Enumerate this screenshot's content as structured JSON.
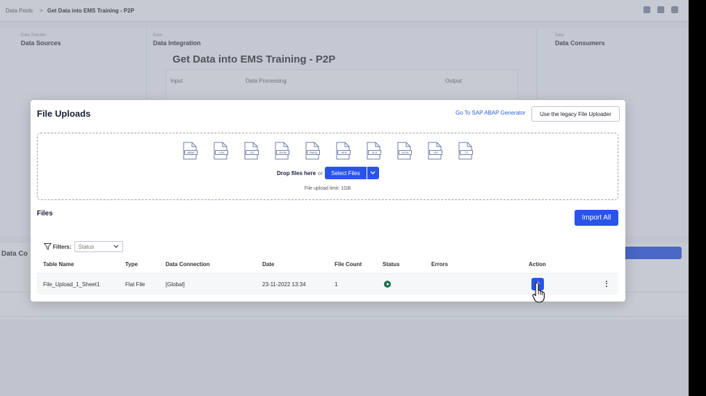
{
  "background": {
    "breadcrumb": [
      "Data Pools",
      "Get Data into EMS Training - P2P"
    ],
    "columns": [
      {
        "small": "Data Transfer",
        "title": "Data Sources"
      },
      {
        "small": "Data",
        "title": "Data Integration"
      },
      {
        "small": "Data",
        "title": "Data Consumers"
      }
    ],
    "pool_title": "Get Data into EMS Training - P2P",
    "card_cols": [
      "Input",
      "Data Processing",
      "Output"
    ],
    "lower_label": "Data Co"
  },
  "modal": {
    "title": "File Uploads",
    "abap_link": "Go To SAP ABAP Generator",
    "legacy_button": "Use the legacy File Uploader",
    "file_types": [
      "ABAP",
      "CSV",
      "GZ",
      "JSON",
      "PARQ",
      "XES",
      "XLS",
      "XLSX",
      "ZIP",
      "7Z"
    ],
    "drop_text": "Drop files here",
    "drop_or": "or",
    "select_button": "Select Files",
    "upload_limit": "File upload limit: 1GB",
    "files_title": "Files",
    "import_button": "Import All",
    "filters_label": "Filters:",
    "status_placeholder": "Status",
    "columns": [
      "Table Name",
      "Type",
      "Data Connection",
      "Date",
      "File Count",
      "Status",
      "Errors",
      "Action"
    ],
    "rows": [
      {
        "table_name": "File_Upload_1_Sheet1",
        "type": "Flat File",
        "connection": "[Global]",
        "date": "23-11-2022 13:34",
        "file_count": "1",
        "errors": ""
      }
    ]
  },
  "colors": {
    "accent": "#2a54e8",
    "status_ok": "#1e6e4e"
  }
}
